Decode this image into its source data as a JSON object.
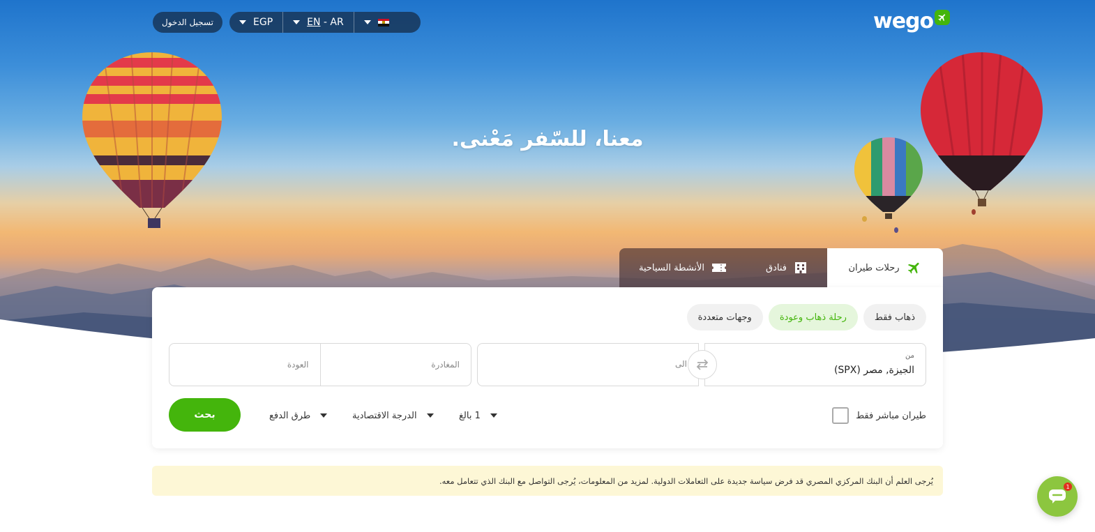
{
  "header": {
    "login_label": "تسجيل الدخول",
    "currency": "EGP",
    "lang_primary": "EN",
    "lang_separator": " - ",
    "lang_secondary": "AR",
    "logo_text": "wego"
  },
  "hero": {
    "headline": "معنا، للسّفر مَعْنى."
  },
  "tabs": [
    {
      "label": "رحلات طيران",
      "icon": "plane-icon"
    },
    {
      "label": "فنادق",
      "icon": "hotel-icon"
    },
    {
      "label": "الأنشطة السياحية",
      "icon": "ticket-icon"
    }
  ],
  "trip_types": {
    "one_way": "ذهاب فقط",
    "round_trip": "رحلة ذهاب وعودة",
    "multi_city": "وجهات متعددة"
  },
  "search": {
    "from_label": "من",
    "from_value": "الجيزة, مصر (SPX)",
    "to_placeholder": "الى",
    "depart_placeholder": "المغادرة",
    "return_placeholder": "العودة",
    "direct_label": "طيران مباشر فقط",
    "passengers": "1 بالغ",
    "cabin_class": "الدرجة الاقتصادية",
    "payment": "طرق الدفع",
    "search_button": "بحث"
  },
  "notice": {
    "text": "يُرجى العلم أن البنك المركزي المصري قد فرض سياسة جديدة على التعاملات الدولية. لمزيد من المعلومات، يُرجى التواصل مع البنك الذي تتعامل معه."
  },
  "chat": {
    "badge": "1"
  },
  "colors": {
    "brand_green": "#44b50c",
    "notice_bg": "#fdf7d6",
    "chat_green": "#8cc63f"
  }
}
